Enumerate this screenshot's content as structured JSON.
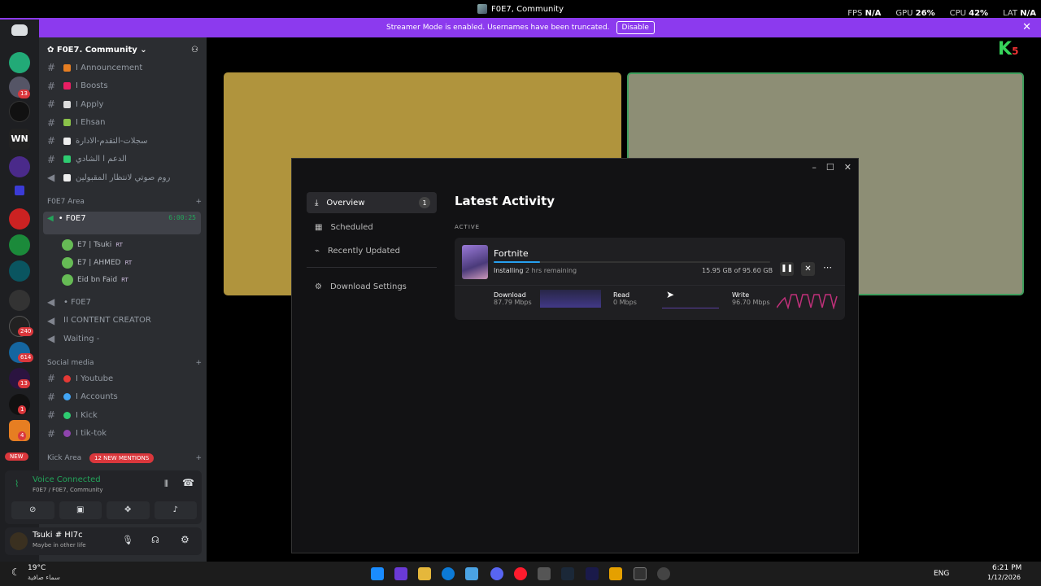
{
  "window": {
    "title": "F0E7, Community"
  },
  "overlay": {
    "fps_label": "FPS",
    "fps": "N/A",
    "gpu_label": "GPU",
    "gpu": "26%",
    "cpu_label": "CPU",
    "cpu": "42%",
    "lat_label": "LAT",
    "lat": "N/A"
  },
  "banner": {
    "text": "Streamer Mode is enabled. Usernames have been truncated.",
    "disable": "Disable"
  },
  "guilds": {
    "badges": [
      "13",
      "240",
      "614",
      "13",
      "1",
      "4"
    ],
    "new_label": "NEW"
  },
  "server": {
    "name": "F0E7. Community"
  },
  "channels_top": [
    {
      "name": "I Announcement",
      "color": "#e67e22"
    },
    {
      "name": "I Boosts",
      "color": "#e91e63"
    },
    {
      "name": "I Apply",
      "color": "#ddd"
    },
    {
      "name": "I Ehsan",
      "color": "#8bc34a"
    },
    {
      "name": "سجلات-التقدم-الادارة",
      "color": "#eee"
    },
    {
      "name": "الدعم ا الشادي",
      "color": "#2ecc71"
    },
    {
      "name": "روم صوتي لانتظار المقبولين",
      "color": "#eee"
    }
  ],
  "cat_area": {
    "label": "F0E7 Area"
  },
  "voice_channel": {
    "name": "• F0E7",
    "timer": "6:00:25"
  },
  "voice_users": [
    {
      "name": "E7 | Tsuki",
      "tag": "RT"
    },
    {
      "name": "E7 | AHMED",
      "tag": "RT"
    },
    {
      "name": "Eid bn Faid",
      "tag": "RT"
    }
  ],
  "voice_channels2": [
    {
      "name": "• F0E7"
    },
    {
      "name": "II CONTENT CREATOR"
    },
    {
      "name": "Waiting -"
    }
  ],
  "cat_social": {
    "label": "Social media"
  },
  "social": [
    {
      "name": "I Youtube",
      "color": "#e53935"
    },
    {
      "name": "I Accounts",
      "color": "#42a5f5"
    },
    {
      "name": "I Kick",
      "color": "#2ecc71"
    },
    {
      "name": "I tik-tok",
      "color": "#8e44ad"
    }
  ],
  "cat_kick": {
    "label": "Kick Area",
    "mentions": "12 NEW MENTIONS"
  },
  "voice_panel": {
    "status": "Voice Connected",
    "sub": "F0E7 / F0E7, Community"
  },
  "user": {
    "name": "Tsuki # HI7c",
    "status": "Maybe in other life"
  },
  "epic": {
    "nav": [
      {
        "label": "Overview",
        "count": "1"
      },
      {
        "label": "Scheduled"
      },
      {
        "label": "Recently Updated"
      },
      {
        "label": "Download Settings"
      }
    ],
    "title": "Latest Activity",
    "section": "ACTIVE",
    "game": "Fortnite",
    "state": "Installing",
    "remaining": "2 hrs remaining",
    "size": "15.95 GB of 95.60 GB",
    "progress": 0.167,
    "download_label": "Download",
    "download_val": "87.79 Mbps",
    "read_label": "Read",
    "read_val": "0 Mbps",
    "write_label": "Write",
    "write_val": "96.70 Mbps"
  },
  "taskbar": {
    "temp": "19°C",
    "weather": "سماء صافية",
    "lang": "ENG",
    "time": "6:21 PM",
    "date": "1/12/2026"
  }
}
